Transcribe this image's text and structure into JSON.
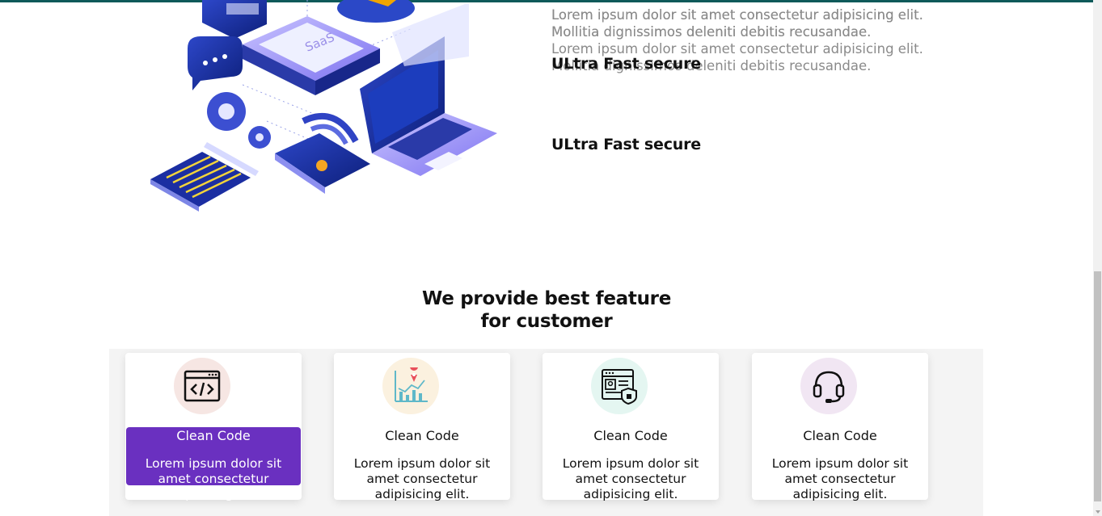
{
  "features": {
    "intro_text": "Lorem ipsum dolor sit amet consectetur adipisicing elit. Mollitia dignissimos deleniti debitis recusandae.",
    "items": [
      {
        "title": "ULtra Fast secure",
        "text": "Lorem ipsum dolor sit amet consectetur adipisicing elit. Mollitia dignissimos deleniti debitis recusandae."
      },
      {
        "title": "ULtra Fast secure",
        "text": "Lorem ipsum dolor sit amet consectetur adipisicing elit. Mollitia dignissimos deleniti debitis recusandae."
      }
    ]
  },
  "hero_art": {
    "label": "SaaS"
  },
  "section": {
    "title_line1": "We provide best feature",
    "title_line2": "for customer"
  },
  "cards": [
    {
      "icon": "code-icon",
      "title": "Clean Code",
      "desc": "Lorem ipsum dolor sit amet consectetur adipisicing elit.",
      "active": true,
      "circle_color": "#f6e6e3"
    },
    {
      "icon": "analytics-icon",
      "title": "Clean Code",
      "desc": "Lorem ipsum dolor sit amet consectetur adipisicing elit.",
      "active": false,
      "circle_color": "#fbf1df"
    },
    {
      "icon": "secure-profile-icon",
      "title": "Clean Code",
      "desc": "Lorem ipsum dolor sit amet consectetur adipisicing elit.",
      "active": false,
      "circle_color": "#e4f6f1"
    },
    {
      "icon": "headset-icon",
      "title": "Clean Code",
      "desc": "Lorem ipsum dolor sit amet consectetur adipisicing elit.",
      "active": false,
      "circle_color": "#f1e6f3"
    }
  ],
  "colors": {
    "accent": "#6a30c0",
    "top_bar": "#0f5a5a",
    "muted_text": "#8a8a8a"
  }
}
